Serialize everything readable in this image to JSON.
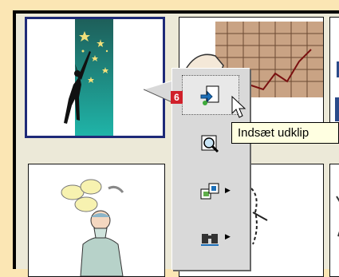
{
  "callout": {
    "step_number": "6"
  },
  "menu": {
    "items": [
      {
        "name": "insert-clip-button",
        "icon": "insert-clip-icon"
      },
      {
        "name": "preview-clip-button",
        "icon": "magnifier-icon"
      },
      {
        "name": "add-to-category-button",
        "icon": "categories-icon",
        "submenu": true
      },
      {
        "name": "find-similar-button",
        "icon": "binoculars-icon",
        "submenu": true
      }
    ]
  },
  "tooltip": {
    "text": "Indsæt udklip"
  },
  "colors": {
    "badge": "#D0202A",
    "selection": "#1E2A78",
    "background": "#FBE6B4",
    "tooltip": "#FFFFE1"
  }
}
